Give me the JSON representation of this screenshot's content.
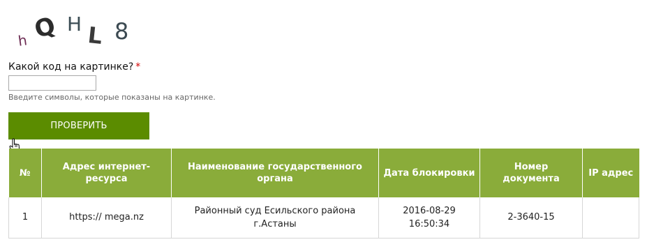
{
  "captcha": {
    "chars": [
      "h",
      "Q",
      "H",
      "L",
      "8"
    ]
  },
  "form": {
    "question_label": "Какой код на картинке?",
    "required_mark": "*",
    "input_value": "",
    "hint": "Введите символы, которые показаны на картинке.",
    "submit_label": "ПРОВЕРИТЬ"
  },
  "colors": {
    "button": "#5b8c00",
    "table_header": "#8aac3a",
    "required": "#d30000"
  },
  "table": {
    "headers": [
      "№",
      "Адрес интернет-ресурса",
      "Наименование государственного органа",
      "Дата блокировки",
      "Номер документа",
      "IP адрес"
    ],
    "rows": [
      [
        "1",
        "https:// mega.nz",
        "Районный суд Есильского района г.Астаны",
        "2016-08-29 16:50:34",
        "2-3640-15",
        ""
      ]
    ]
  }
}
